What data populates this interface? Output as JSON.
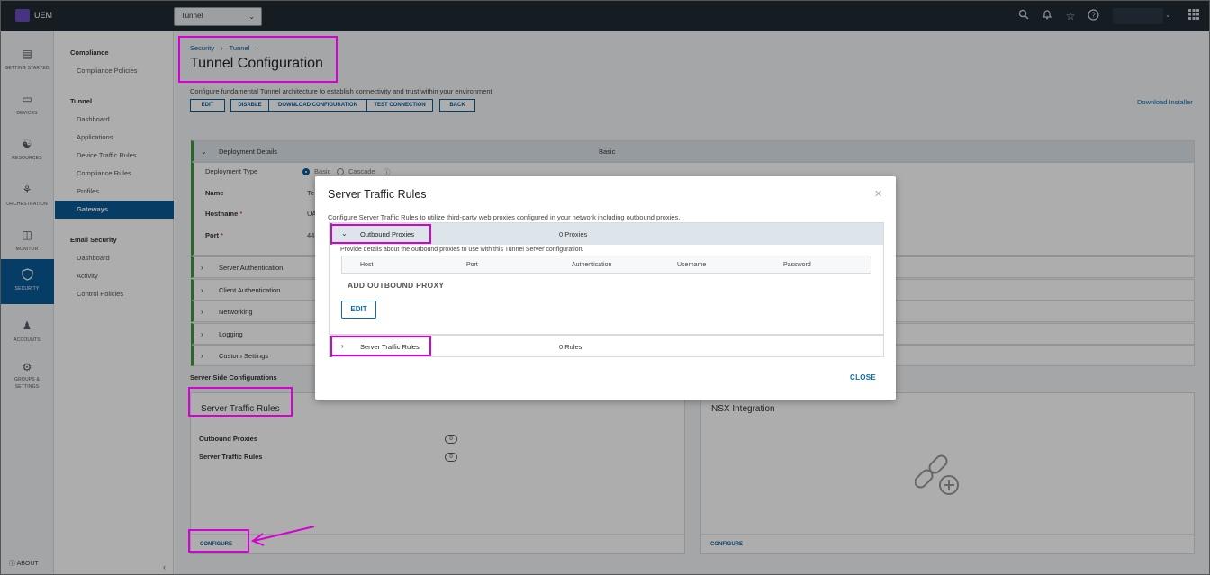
{
  "app": {
    "name": "UEM"
  },
  "header": {
    "org_value": "Tunnel"
  },
  "left_nav": [
    {
      "label": "GETTING STARTED",
      "icon": "clipboard-icon"
    },
    {
      "label": "DEVICES",
      "icon": "devices-icon"
    },
    {
      "label": "RESOURCES",
      "icon": "resources-icon"
    },
    {
      "label": "ORCHESTRATION",
      "icon": "orchestration-icon"
    },
    {
      "label": "MONITOR",
      "icon": "monitor-icon"
    },
    {
      "label": "SECURITY",
      "icon": "shield-icon"
    },
    {
      "label": "ACCOUNTS",
      "icon": "accounts-icon"
    },
    {
      "label": "GROUPS & SETTINGS",
      "icon": "gear-icon"
    }
  ],
  "about": "ABOUT",
  "sub_nav": {
    "compliance_header": "Compliance",
    "compliance_policies": "Compliance Policies",
    "tunnel_header": "Tunnel",
    "tunnel_items": [
      "Dashboard",
      "Applications",
      "Device Traffic Rules",
      "Compliance Rules",
      "Profiles"
    ],
    "tunnel_active": "Gateways",
    "email_header": "Email Security",
    "email_items": [
      "Dashboard",
      "Activity",
      "Control Policies"
    ]
  },
  "breadcrumb": [
    "Security",
    "Tunnel"
  ],
  "page": {
    "title": "Tunnel Configuration",
    "description": "Configure fundamental Tunnel architecture to establish connectivity and trust within your environment",
    "buttons": [
      "EDIT",
      "DISABLE",
      "DOWNLOAD CONFIGURATION",
      "TEST CONNECTION",
      "BACK"
    ],
    "download_installer": "Download Installer"
  },
  "deployment": {
    "title": "Deployment Details",
    "summary": "Basic",
    "type_label": "Deployment Type",
    "opt_basic": "Basic",
    "opt_cascade": "Cascade",
    "name_label": "Name",
    "name_value": "Te",
    "hostname_label": "Hostname",
    "hostname_value": "UA",
    "port_label": "Port",
    "port_value": "44",
    "required": "*"
  },
  "sections": [
    "Server Authentication",
    "Client Authentication",
    "Networking",
    "Logging",
    "Custom Settings"
  ],
  "server_side": {
    "header": "Server Side Configurations",
    "str_card": {
      "title": "Server Traffic Rules",
      "outbound_label": "Outbound Proxies",
      "outbound_count": "0",
      "rules_label": "Server Traffic Rules",
      "rules_count": "0",
      "configure": "CONFIGURE"
    },
    "nsx_card": {
      "title": "NSX Integration",
      "configure": "CONFIGURE"
    }
  },
  "modal": {
    "title": "Server Traffic Rules",
    "description": "Configure Server Traffic Rules to utilize third-party web proxies configured in your network including outbound proxies.",
    "outbound": {
      "title": "Outbound Proxies",
      "meta": "0 Proxies",
      "desc": "Provide details about the outbound proxies to use with this Tunnel Server configuration.",
      "columns": [
        "Host",
        "Port",
        "Authentication",
        "Username",
        "Password"
      ],
      "add": "ADD OUTBOUND PROXY",
      "edit": "EDIT"
    },
    "rules": {
      "title": "Server Traffic Rules",
      "meta": "0 Rules"
    },
    "close": "CLOSE"
  },
  "colors": {
    "accent": "#0a5a99",
    "highlight": "#d400d4",
    "topbar": "#1f2a33",
    "success": "#3a9a3a"
  }
}
